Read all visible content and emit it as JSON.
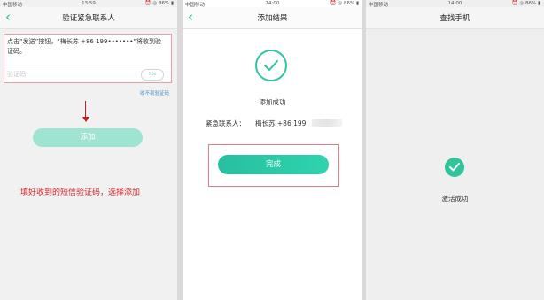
{
  "phones": [
    {
      "status": {
        "carrier": "中国移动",
        "time": "13:59",
        "right": "⏰ ◎ 86% ▮"
      },
      "nav": {
        "back_icon": "‹",
        "title": "验证紧急联系人"
      },
      "sms_text": "点击“发送”按钮，“梅长苏 +86 199•••••••”将收到验证码。",
      "code_placeholder": "验证码",
      "resend_label": "59s",
      "no_code_link": "收不到验证码",
      "add_button": "添加",
      "instruction": "填好收到的短信验证码，选择添加"
    },
    {
      "status": {
        "carrier": "中国移动",
        "time": "14:00",
        "right": "⏰ ◎ 86% ▮"
      },
      "nav": {
        "back_icon": "‹",
        "title": "添加结果"
      },
      "result_text": "添加成功",
      "contact_label": "紧急联系人：",
      "contact_value": "梅长苏 +86 199",
      "done_button": "完成"
    },
    {
      "status": {
        "carrier": "中国移动",
        "time": "14:00",
        "right": "⏰ ◎ 86% ▮"
      },
      "nav": {
        "title": "查找手机"
      },
      "activated_text": "激活成功"
    }
  ],
  "colors": {
    "accent": "#2fc4a3",
    "highlight": "#e57a86",
    "instruction": "#d8262d"
  }
}
